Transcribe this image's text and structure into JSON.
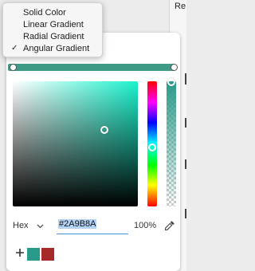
{
  "background": {
    "right_panel_text": "Re"
  },
  "picker": {
    "gradient_color": "#3F9A85",
    "saturation_brightness_hue_color": "#1BF2CD",
    "selected_color": "#2A9B8A",
    "format_label": "Hex",
    "hex_value": "#2A9B8A",
    "opacity": "100%",
    "swatches": [
      {
        "color": "#2A9B8A"
      },
      {
        "color": "#A62A2A"
      }
    ]
  },
  "gradient_menu": {
    "items": [
      {
        "label": "Solid Color",
        "checked": false
      },
      {
        "label": "Linear Gradient",
        "checked": false
      },
      {
        "label": "Radial Gradient",
        "checked": false
      },
      {
        "label": "Angular Gradient",
        "checked": true
      }
    ],
    "check_glyph": "✓"
  },
  "icons": {
    "format_dropdown": "chevron-down-icon",
    "eyedropper": "eyedropper-icon",
    "add_swatch": "plus-icon"
  }
}
